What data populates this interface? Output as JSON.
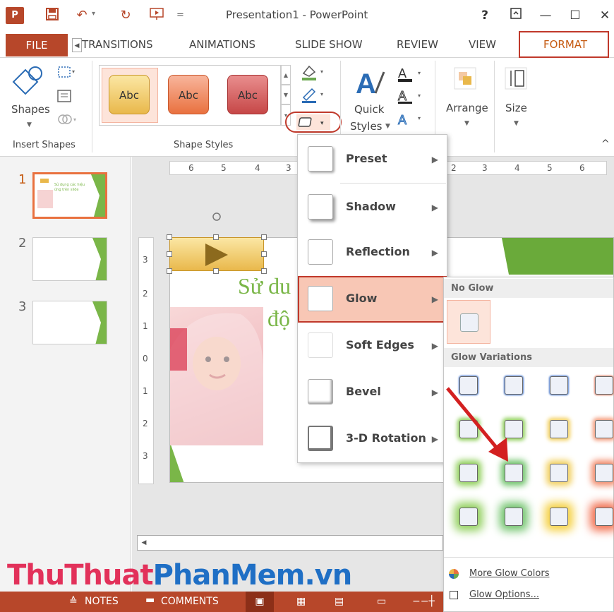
{
  "window": {
    "title": "Presentation1 - PowerPoint",
    "help": "?",
    "minimize": "—",
    "restore": "☐",
    "close": "✕",
    "ribbon_display": "⊼"
  },
  "quick_access": {
    "undo_dropdown": "▾",
    "customize": "="
  },
  "tabs": {
    "file": "FILE",
    "transitions": "TRANSITIONS",
    "animations": "ANIMATIONS",
    "slide_show": "SLIDE SHOW",
    "review": "REVIEW",
    "view": "VIEW",
    "format": "FORMAT"
  },
  "ribbon": {
    "shapes": "Shapes",
    "insert_shapes": "Insert Shapes",
    "shape_styles": "Shape Styles",
    "style_swatches": [
      "Abc",
      "Abc",
      "Abc"
    ],
    "quick_styles_1": "Quick",
    "quick_styles_2": "Styles",
    "arrange": "Arrange",
    "size": "Size",
    "collapse": "^"
  },
  "slides": {
    "numbers": [
      "1",
      "2",
      "3"
    ],
    "thumb1_text": "Sử dụng các hiệu ứng trên slide"
  },
  "ruler": {
    "h_left": [
      "6",
      "5",
      "4",
      "3"
    ],
    "h_right": [
      "2",
      "3",
      "4",
      "5",
      "6"
    ],
    "v": [
      "3",
      "2",
      "1",
      "0",
      "1",
      "2",
      "3"
    ]
  },
  "slide_text": {
    "line1": "Sử du",
    "line2": "độ"
  },
  "effects_menu": {
    "items": [
      {
        "label": "Preset",
        "arrow": "▶"
      },
      {
        "label": "Shadow",
        "arrow": "▶"
      },
      {
        "label": "Reflection",
        "arrow": "▶"
      },
      {
        "label": "Glow",
        "arrow": "▶"
      },
      {
        "label": "Soft Edges",
        "arrow": "▶"
      },
      {
        "label": "Bevel",
        "arrow": "▶"
      },
      {
        "label": "3-D Rotation",
        "arrow": "▶"
      }
    ]
  },
  "glow_menu": {
    "no_glow": "No Glow",
    "variations": "Glow Variations",
    "more_colors": "More Glow Colors",
    "options": "Glow Options...",
    "rows": [
      [
        "#4a7bd0",
        "#4a7bd0",
        "#4a7bd0",
        "#e0826a"
      ],
      [
        "#8fcf5a",
        "#8fcf5a",
        "#f2d060",
        "#f29a7a"
      ],
      [
        "#8fcf5a",
        "#6fc36a",
        "#f2d060",
        "#f28a6a"
      ],
      [
        "#8fcf5a",
        "#6fc36a",
        "#f5d040",
        "#f27050"
      ]
    ]
  },
  "status": {
    "notes": "NOTES",
    "comments": "COMMENTS"
  },
  "watermark": {
    "part1": "ThuThuat",
    "part2": "PhanMem",
    "part3": ".vn"
  },
  "colors": {
    "accent": "#b7472a",
    "format_tab": "#c55a11",
    "highlight": "#c0392b",
    "hover": "#f4b4a0"
  }
}
